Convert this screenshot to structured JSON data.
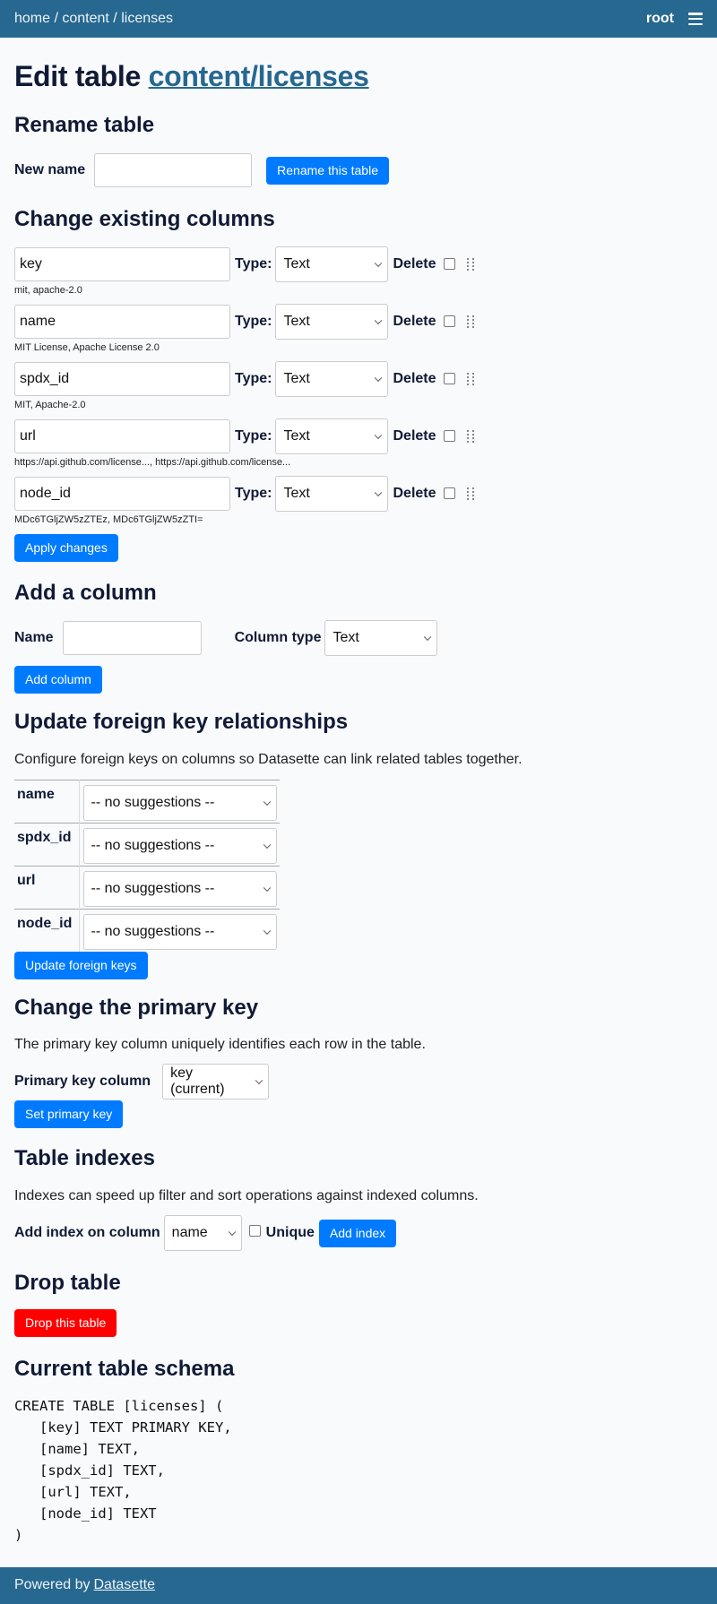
{
  "header": {
    "breadcrumbs": [
      "home",
      "content",
      "licenses"
    ],
    "separator": " / ",
    "user": "root",
    "menu_icon": "hamburger-icon"
  },
  "page": {
    "title_prefix": "Edit table",
    "title_link": "content/licenses"
  },
  "rename": {
    "heading": "Rename table",
    "label": "New name",
    "value": "",
    "button": "Rename this table"
  },
  "columns": {
    "heading": "Change existing columns",
    "type_label": "Type:",
    "delete_label": "Delete",
    "items": [
      {
        "name": "key",
        "type": "Text",
        "examples": "mit, apache-2.0"
      },
      {
        "name": "name",
        "type": "Text",
        "examples": "MIT License, Apache License 2.0"
      },
      {
        "name": "spdx_id",
        "type": "Text",
        "examples": "MIT, Apache-2.0"
      },
      {
        "name": "url",
        "type": "Text",
        "examples": "https://api.github.com/license..., https://api.github.com/license..."
      },
      {
        "name": "node_id",
        "type": "Text",
        "examples": "MDc6TGljZW5zZTEz, MDc6TGljZW5zZTI="
      }
    ],
    "apply_button": "Apply changes"
  },
  "add_column": {
    "heading": "Add a column",
    "name_label": "Name",
    "name_value": "",
    "type_label": "Column type",
    "type_value": "Text",
    "button": "Add column"
  },
  "foreign_keys": {
    "heading": "Update foreign key relationships",
    "description": "Configure foreign keys on columns so Datasette can link related tables together.",
    "rows": [
      {
        "column": "name",
        "value": "-- no suggestions --"
      },
      {
        "column": "spdx_id",
        "value": "-- no suggestions --"
      },
      {
        "column": "url",
        "value": "-- no suggestions --"
      },
      {
        "column": "node_id",
        "value": "-- no suggestions --"
      }
    ],
    "button": "Update foreign keys"
  },
  "primary_key": {
    "heading": "Change the primary key",
    "description": "The primary key column uniquely identifies each row in the table.",
    "label": "Primary key column",
    "value": "key (current)",
    "button": "Set primary key"
  },
  "indexes": {
    "heading": "Table indexes",
    "description": "Indexes can speed up filter and sort operations against indexed columns.",
    "label": "Add index on column",
    "column_value": "name",
    "unique_label": "Unique",
    "button": "Add index"
  },
  "drop": {
    "heading": "Drop table",
    "button": "Drop this table",
    "button_color": "#ff0000"
  },
  "schema": {
    "heading": "Current table schema",
    "sql": "CREATE TABLE [licenses] (\n   [key] TEXT PRIMARY KEY,\n   [name] TEXT,\n   [spdx_id] TEXT,\n   [url] TEXT,\n   [node_id] TEXT\n)"
  },
  "footer": {
    "prefix": "Powered by",
    "link": "Datasette"
  },
  "colors": {
    "header_bg": "#276890",
    "primary_button": "#007bff",
    "danger_button": "#ff0000"
  }
}
